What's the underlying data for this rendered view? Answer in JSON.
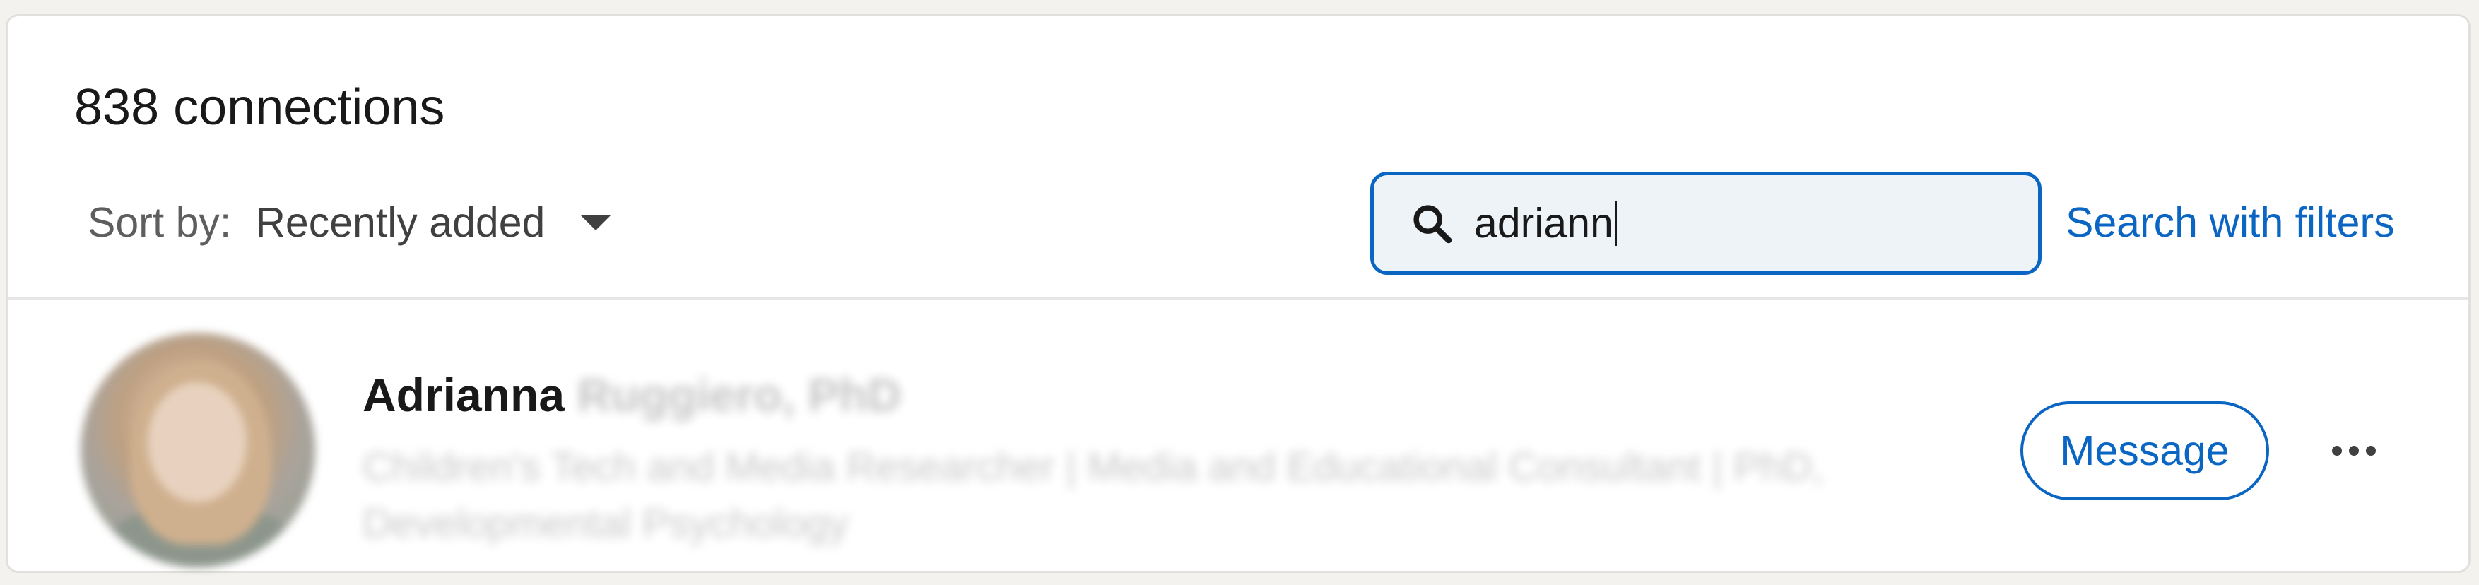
{
  "header": {
    "connections_count": "838 connections"
  },
  "sort": {
    "label": "Sort by:",
    "value": "Recently added"
  },
  "search": {
    "value": "adriann",
    "filters_link": "Search with filters"
  },
  "connection": {
    "first_name": "Adrianna",
    "last_name": "Ruggiero, PhD",
    "headline": "Children's Tech and Media Researcher | Media and Educational Consultant | PhD, Developmental Psychology",
    "message_label": "Message",
    "more_icon": "ellipsis-icon"
  },
  "colors": {
    "accent": "#0a66c2",
    "text_primary": "#191919",
    "text_secondary": "#5e5e5e",
    "background": "#f3f2ef"
  }
}
